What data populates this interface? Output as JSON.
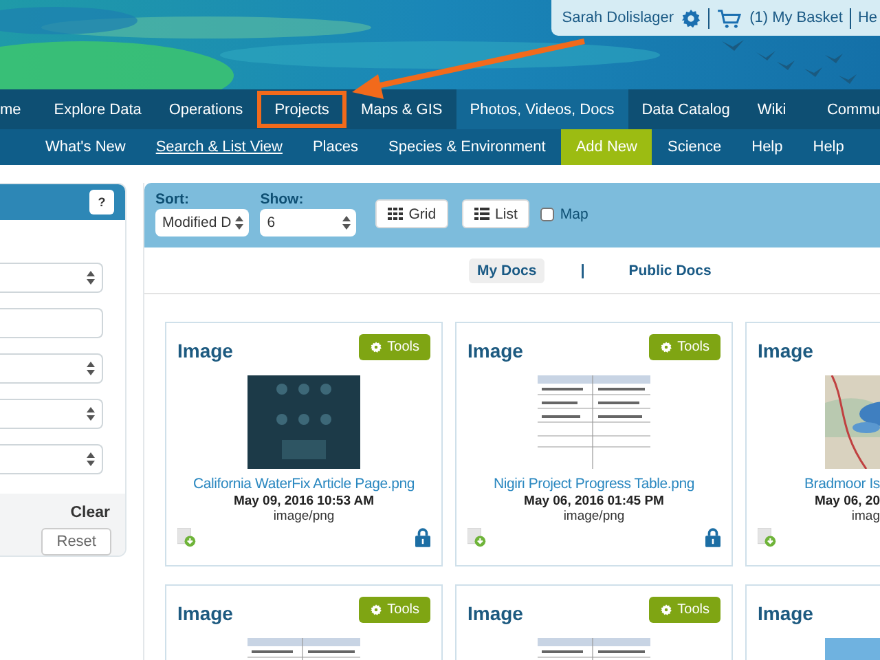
{
  "user_bar": {
    "user": "Sarah Dolislager",
    "basket": "(1) My Basket",
    "help": "He"
  },
  "nav": [
    {
      "label": "me",
      "selected": false,
      "annotated": false
    },
    {
      "label": "Explore Data",
      "selected": false,
      "annotated": false
    },
    {
      "label": "Operations",
      "selected": false,
      "annotated": false
    },
    {
      "label": "Projects",
      "selected": false,
      "annotated": true
    },
    {
      "label": "Maps & GIS",
      "selected": false,
      "annotated": false
    },
    {
      "label": "Photos, Videos, Docs",
      "selected": true,
      "annotated": false
    },
    {
      "label": "Data Catalog",
      "selected": false,
      "annotated": false
    },
    {
      "label": "Wiki",
      "selected": false,
      "annotated": false
    },
    {
      "label": "Commu",
      "selected": false,
      "annotated": false
    }
  ],
  "subnav": [
    {
      "label": "What's New",
      "selected": false,
      "accent": false
    },
    {
      "label": "Search & List View",
      "selected": true,
      "accent": false
    },
    {
      "label": "Places",
      "selected": false,
      "accent": false
    },
    {
      "label": "Species & Environment",
      "selected": false,
      "accent": false
    },
    {
      "label": "Add New",
      "selected": false,
      "accent": true
    },
    {
      "label": "Science",
      "selected": false,
      "accent": false
    },
    {
      "label": "Help",
      "selected": false,
      "accent": false
    },
    {
      "label": "Help",
      "selected": false,
      "accent": false
    }
  ],
  "filter_panel": {
    "help": "?",
    "fields": [
      {
        "kind": "select"
      },
      {
        "kind": "input"
      },
      {
        "kind": "select"
      },
      {
        "kind": "select"
      },
      {
        "kind": "select"
      }
    ],
    "clear": "Clear",
    "reset": "Reset"
  },
  "toolbar": {
    "sort_label": "Sort:",
    "sort_value": "Modified D",
    "show_label": "Show:",
    "show_value": "6",
    "views": [
      {
        "label": "Grid",
        "kind": "grid"
      },
      {
        "label": "List",
        "kind": "list"
      }
    ],
    "map": {
      "label": "Map",
      "checked": false
    }
  },
  "doc_tabs": [
    {
      "label": "My Docs",
      "selected": true
    },
    {
      "label": "|",
      "kind": "separator"
    },
    {
      "label": "Public Docs",
      "selected": false
    }
  ],
  "cards": [
    {
      "type": "Image",
      "tools": "Tools",
      "name": "California WaterFix Article Page.png",
      "date": "May 09, 2016 10:53 AM",
      "mime": "image/png",
      "locked": true
    },
    {
      "type": "Image",
      "tools": "Tools",
      "name": "Nigiri Project Progress Table.png",
      "date": "May 06, 2016 01:45 PM",
      "mime": "image/png",
      "locked": true
    },
    {
      "type": "Image",
      "name": "Bradmoor Is",
      "date": "May 06, 20",
      "mime": "imag"
    },
    {
      "type": "Image",
      "tools": "Tools"
    },
    {
      "type": "Image",
      "tools": "Tools"
    },
    {
      "type": "Image"
    }
  ]
}
